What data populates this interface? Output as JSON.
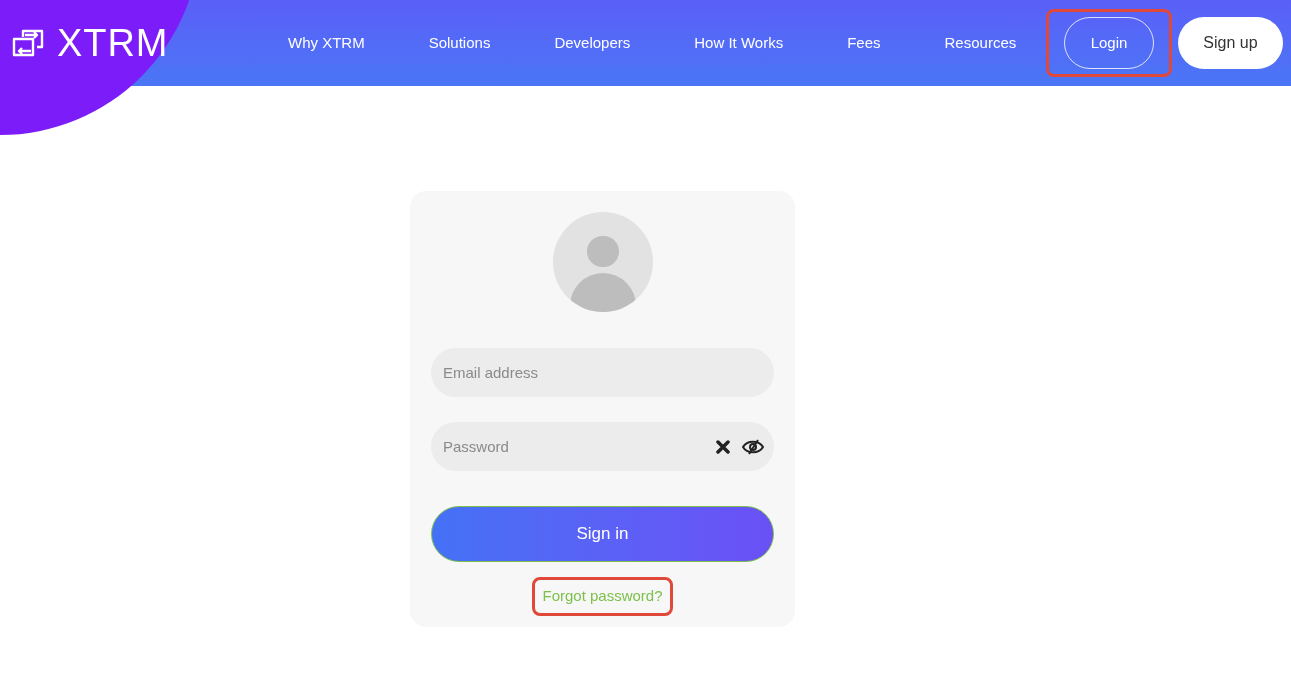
{
  "logo": {
    "text": "XTRM"
  },
  "nav": [
    {
      "label": "Why XTRM"
    },
    {
      "label": "Solutions"
    },
    {
      "label": "Developers"
    },
    {
      "label": "How It Works"
    },
    {
      "label": "Fees"
    },
    {
      "label": "Resources"
    }
  ],
  "login_button": {
    "label": "Login",
    "highlighted": true
  },
  "signup_button": {
    "label": "Sign up"
  },
  "form": {
    "email": {
      "placeholder": "Email address"
    },
    "password": {
      "placeholder": "Password"
    },
    "submit": {
      "label": "Sign in"
    },
    "forgot": {
      "label": "Forgot password?",
      "highlighted": true
    }
  }
}
